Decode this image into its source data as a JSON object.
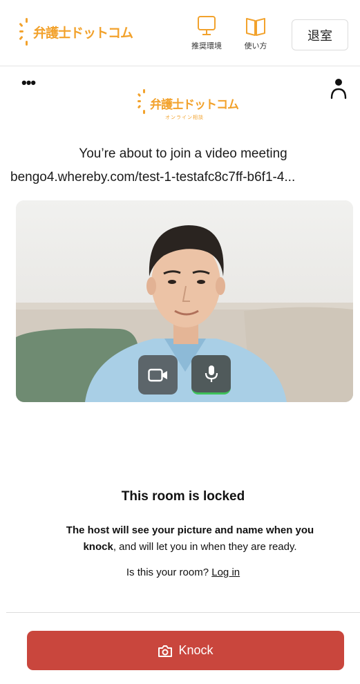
{
  "header": {
    "brand_name": "弁護士ドットコム",
    "recommended_env_label": "推奨環境",
    "howto_label": "使い方",
    "exit_label": "退室"
  },
  "frame": {
    "logo_main": "弁護士ドットコム",
    "logo_sub": "オンライン相談",
    "join_title": "You’re about to join a video meeting",
    "room_url": "bengo4.whereby.com/test-1-testafc8c7ff-b6f1-4...",
    "locked_title": "This room is locked",
    "locked_desc_bold1": "The host will see your picture and name when you",
    "locked_desc_bold2": "knock",
    "locked_desc_rest": ", and will let you in when they are ready.",
    "owner_prompt": "Is this your room? ",
    "login_link": "Log in",
    "knock_label": "Knock"
  },
  "icons": {
    "more": "more-options-icon",
    "profile": "person-icon",
    "camera": "video-camera-icon",
    "microphone": "microphone-icon",
    "knock": "camera-icon",
    "monitor": "monitor-icon",
    "book": "book-icon"
  },
  "colors": {
    "brand_orange": "#f2a22c",
    "knock_red": "#c9463d",
    "mic_active_green": "#3ec15a"
  }
}
